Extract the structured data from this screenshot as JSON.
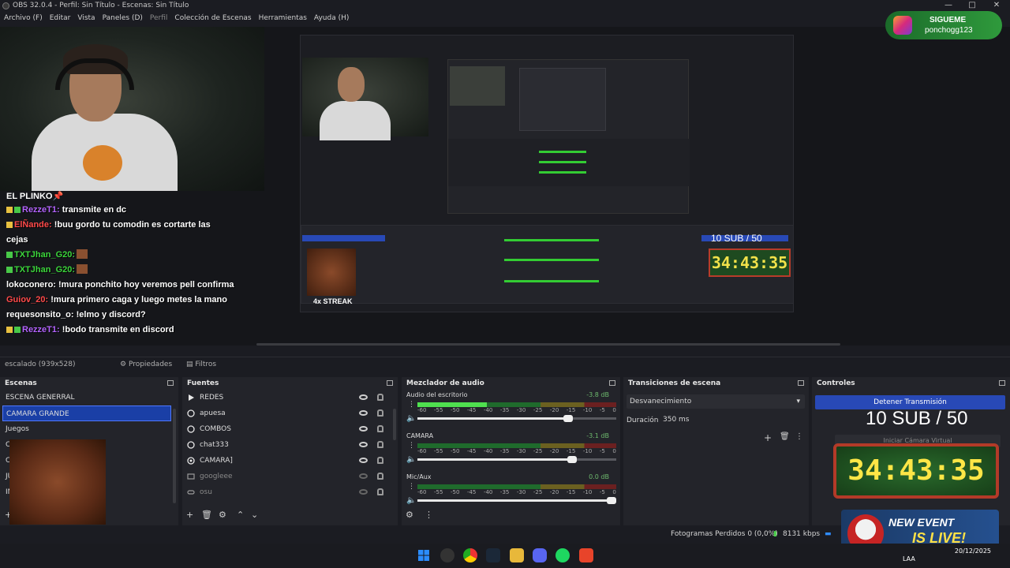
{
  "window": {
    "title": "OBS 32.0.4 - Perfil: Sin Título - Escenas: Sin Título",
    "minimize": "—",
    "maximize": "□",
    "close": "✕"
  },
  "menu": [
    "Archivo (F)",
    "Editar",
    "Vista",
    "Paneles (D)",
    "Perfil",
    "Colección de Escenas",
    "Herramientas",
    "Ayuda (H)"
  ],
  "overlay": {
    "follow_title": "SIGUEME",
    "follow_handle": "ponchogg123",
    "chat_header": "EL PLINKO📌",
    "chat": [
      {
        "user": "RezzeT1:",
        "text": "transmite en dc",
        "color": "u1"
      },
      {
        "user": "ElÑande:",
        "text": "!buu gordo tu comodin es cortarte las",
        "color": "u3"
      },
      {
        "user": "",
        "text": "cejas",
        "color": "u4"
      },
      {
        "user": "TXTJhan_G20:",
        "text": "",
        "color": "u2"
      },
      {
        "user": "TXTJhan_G20:",
        "text": "",
        "color": "u2"
      },
      {
        "user": "lokoconero:",
        "text": "!mura ponchito hoy veremos pell confirma",
        "color": "u4"
      },
      {
        "user": "Guiov_20:",
        "text": "!mura primero caga y luego metes la mano",
        "color": "u3"
      },
      {
        "user": "requesonsito_o:",
        "text": "!elmo y discord?",
        "color": "u4"
      },
      {
        "user": "RezzeT1:",
        "text": "!bodo transmite en discord",
        "color": "u1"
      }
    ],
    "nested_streak": "4x STREAK",
    "nested_sub": "10 SUB / 50",
    "nested_clock": "34:43:35"
  },
  "source_toolbar": {
    "selected_source": "escalado (939x528)",
    "properties": "Propiedades",
    "filters": "Filtros"
  },
  "panels": {
    "scenes_title": "Escenas",
    "sources_title": "Fuentes",
    "mixer_title": "Mezclador de audio",
    "transitions_title": "Transiciones de escena",
    "controls_title": "Controles"
  },
  "scenes": [
    "ESCENA GENERRAL",
    "CAMARA GRANDE",
    "Juegos",
    "CLASH",
    "CASINO",
    "JUEGOS",
    "INICIO DE STREAM"
  ],
  "selected_scene_index": 1,
  "sources": [
    {
      "name": "REDES",
      "icon": "play-icon",
      "visible": true
    },
    {
      "name": "apuesa",
      "icon": "browser-icon",
      "visible": true
    },
    {
      "name": "COMBOS",
      "icon": "browser-icon",
      "visible": true
    },
    {
      "name": "chat333",
      "icon": "browser-icon",
      "visible": true
    },
    {
      "name": "CAMARA]",
      "icon": "camera-icon",
      "visible": true
    },
    {
      "name": "googleee",
      "icon": "image-icon",
      "visible": false
    },
    {
      "name": "osu",
      "icon": "game-icon",
      "visible": false
    }
  ],
  "mixer": [
    {
      "name": "Audio del escritorio",
      "db": "-3.8 dB",
      "level": 0.35,
      "volume": 0.78
    },
    {
      "name": "CAMARA",
      "db": "-3.1 dB",
      "level": 0.0,
      "volume": 0.8
    },
    {
      "name": "Mic/Aux",
      "db": "0.0 dB",
      "level": 0.0,
      "volume": 1.0
    }
  ],
  "mixer_scale": [
    "-60",
    "-55",
    "-50",
    "-45",
    "-40",
    "-35",
    "-30",
    "-25",
    "-20",
    "-15",
    "-10",
    "-5",
    "0"
  ],
  "transitions": {
    "type": "Desvanecimiento",
    "duration_label": "Duración",
    "duration_value": "350 ms"
  },
  "controls": {
    "stop_stream": "Detener Transmisión",
    "virtual_cam": "Iniciar Cámara Virtual",
    "sub_counter": "10 SUB / 50",
    "timer": "34:43:35",
    "event_line1": "NEW EVENT",
    "event_line2": "IS LIVE!"
  },
  "streak_label": "4x STREAK",
  "status": {
    "dropped_frames": "Fotogramas Perdidos 0 (0,0%)",
    "bitrate": "8131 kbps"
  },
  "taskbar": {
    "lang": "LAA",
    "time": "",
    "date": "20/12/2025"
  }
}
